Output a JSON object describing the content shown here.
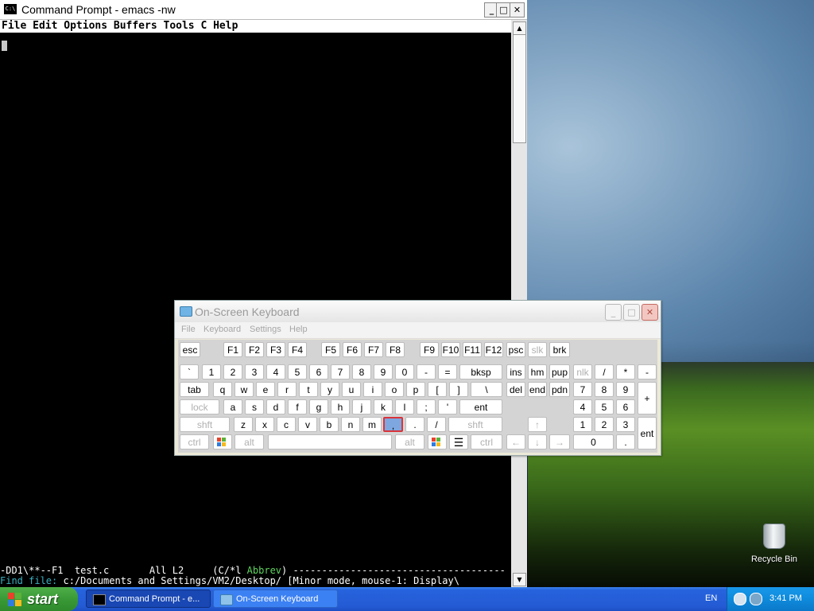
{
  "desktop": {
    "recycle_bin_label": "Recycle Bin"
  },
  "cmd_window": {
    "icon_text": "C:\\",
    "title": "Command Prompt - emacs -nw",
    "buttons": {
      "minimize": "_",
      "maximize": "□",
      "close": "✕"
    },
    "emacs": {
      "menu": "File Edit Options Buffers Tools C Help",
      "modeline_left": "-DD1\\**--F1  test.c       All L2     (C/*l ",
      "modeline_abbrev": "Abbrev",
      "modeline_right": ") -------------------------------------",
      "minibuffer_prompt": "Find file: ",
      "minibuffer_text": "c:/Documents and Settings/VM2/Desktop/ [Minor mode, mouse-1: Display\\"
    }
  },
  "osk": {
    "title": "On-Screen Keyboard",
    "menu": [
      "File",
      "Keyboard",
      "Settings",
      "Help"
    ],
    "title_buttons": {
      "minimize": "_",
      "maximize": "□",
      "close": "✕"
    },
    "rows": {
      "func": [
        "esc",
        "F1",
        "F2",
        "F3",
        "F4",
        "F5",
        "F6",
        "F7",
        "F8",
        "F9",
        "F10",
        "F11",
        "F12",
        "psc",
        "slk",
        "brk"
      ],
      "num": [
        "`",
        "1",
        "2",
        "3",
        "4",
        "5",
        "6",
        "7",
        "8",
        "9",
        "0",
        "-",
        "=",
        "bksp",
        "ins",
        "hm",
        "pup",
        "nlk",
        "/",
        "*",
        "-"
      ],
      "tab": [
        "tab",
        "q",
        "w",
        "e",
        "r",
        "t",
        "y",
        "u",
        "i",
        "o",
        "p",
        "[",
        "]",
        "\\",
        "del",
        "end",
        "pdn",
        "7",
        "8",
        "9",
        "+"
      ],
      "home": [
        "lock",
        "a",
        "s",
        "d",
        "f",
        "g",
        "h",
        "j",
        "k",
        "l",
        ";",
        "'",
        "ent",
        "4",
        "5",
        "6"
      ],
      "shift": [
        "shft",
        "z",
        "x",
        "c",
        "v",
        "b",
        "n",
        "m",
        ",",
        ".",
        "/",
        "shft",
        "↑",
        "1",
        "2",
        "3",
        "ent"
      ],
      "bottom": [
        "ctrl",
        "alt",
        "alt",
        "ctrl",
        "←",
        "↓",
        "→",
        "0",
        "."
      ]
    }
  },
  "taskbar": {
    "start_label": "start",
    "tasks": [
      {
        "label": "Command Prompt - e...",
        "active": true
      },
      {
        "label": "On-Screen Keyboard",
        "active": false
      }
    ],
    "language": "EN",
    "clock": "3:41 PM"
  },
  "colors": {
    "taskbar_blue": "#245bd4",
    "start_green": "#3a9a36",
    "selected_key": "#7ea7e0",
    "selected_key_border": "#d9343a",
    "emacs_abbrev_green": "#5fd35f"
  }
}
